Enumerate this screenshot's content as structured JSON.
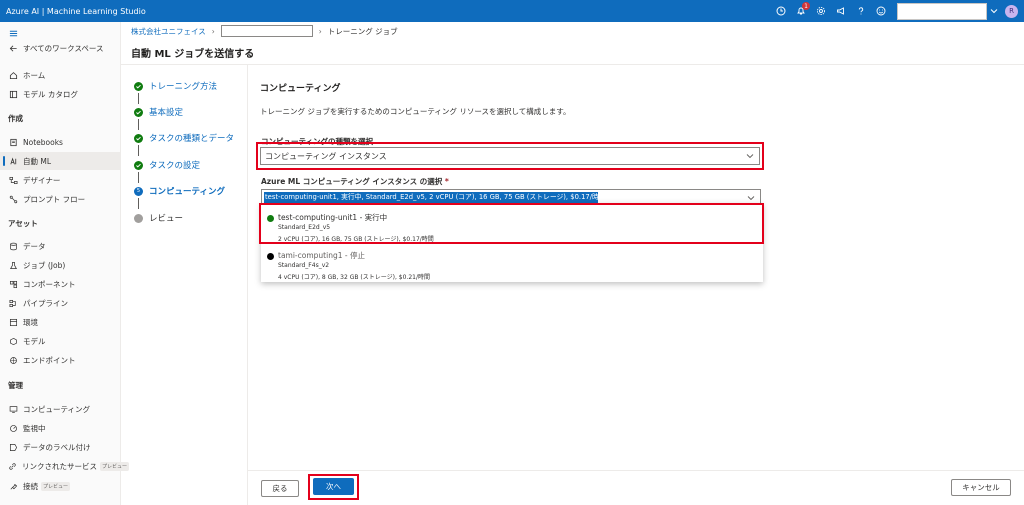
{
  "topbar": {
    "title": "Azure AI | Machine Learning Studio",
    "notification_count": "1",
    "avatar_initial": "R"
  },
  "nav": {
    "back_label": "すべてのワークスペース",
    "home": "ホーム",
    "model_catalog": "モデル カタログ",
    "section_author": "作成",
    "notebooks": "Notebooks",
    "automl": "自動 ML",
    "designer": "デザイナー",
    "prompt_flow": "プロンプト フロー",
    "section_assets": "アセット",
    "data": "データ",
    "jobs": "ジョブ (Job)",
    "components": "コンポーネント",
    "pipelines": "パイプライン",
    "environments": "環境",
    "models": "モデル",
    "endpoints": "エンドポイント",
    "section_manage": "管理",
    "compute": "コンピューティング",
    "monitoring": "監視中",
    "data_labeling": "データのラベル付け",
    "linked_services": "リンクされたサービス",
    "connections": "接続",
    "preview": "プレビュー"
  },
  "breadcrumb": {
    "org": "株式会社ユニフェイス",
    "current": "トレーニング ジョブ"
  },
  "page_title": "自動 ML ジョブを送信する",
  "steps": [
    {
      "label": "トレーニング方法"
    },
    {
      "label": "基本設定"
    },
    {
      "label": "タスクの種類とデータ"
    },
    {
      "label": "タスクの設定"
    },
    {
      "label": "コンピューティング",
      "num": "5"
    },
    {
      "label": "レビュー"
    }
  ],
  "main": {
    "section_title": "コンピューティング",
    "description": "トレーニング ジョブを実行するためのコンピューティング リソースを選択して構成します。",
    "compute_type_label": "コンピューティングの種類を選択",
    "compute_type_value": "コンピューティング インスタンス",
    "instance_label": "Azure ML コンピューティング インスタンス の選択",
    "required_mark": "*",
    "instance_value": "test-computing-unit1, 実行中, Standard_E2d_v5, 2 vCPU (コア), 16 GB, 75 GB (ストレージ), $0.17/時間",
    "options": [
      {
        "name": "test-computing-unit1 - 実行中",
        "sku": "Standard_E2d_v5",
        "spec": "2 vCPU (コア), 16 GB, 75 GB (ストレージ), $0.17/時間",
        "status_color": "#107c10"
      },
      {
        "name": "tami-computing1 - 停止",
        "sku": "Standard_F4s_v2",
        "spec": "4 vCPU (コア), 8 GB, 32 GB (ストレージ), $0.21/時間",
        "status_color": "#000000"
      }
    ]
  },
  "footer": {
    "back": "戻る",
    "next": "次へ",
    "cancel": "キャンセル"
  },
  "colors": {
    "accent": "#0f6cbd",
    "highlight_box": "#e3001b",
    "done": "#107c10"
  }
}
